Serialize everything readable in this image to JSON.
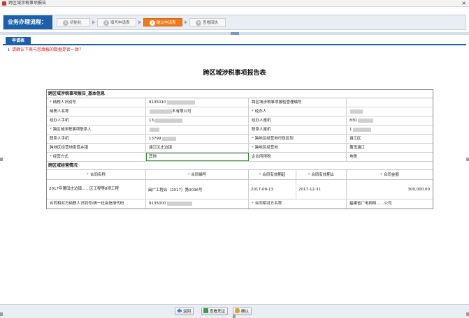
{
  "window": {
    "title": "跨区域涉税事项报告"
  },
  "flow": {
    "title": "业务办理流程：",
    "steps": [
      {
        "num": "1",
        "label": "初始化"
      },
      {
        "num": "2",
        "label": "填写申请表"
      },
      {
        "num": "3",
        "label": "确认申请表"
      },
      {
        "num": "4",
        "label": "查看回执"
      }
    ],
    "active_index": 2
  },
  "tab": {
    "label": "申请表"
  },
  "notice": "请确认下表与您填报的数据是否一致？",
  "report": {
    "title": "跨区域涉税事项报告表",
    "basic_section": "跨区域涉税事项报告_基本信息",
    "rows": [
      {
        "l1": "纳税人识别号",
        "s1": true,
        "v1": "9135010",
        "l2": "跨区域涉税事项报验管理编号",
        "s2": false,
        "v2": ""
      },
      {
        "l1": "纳税人名称",
        "s1": false,
        "v1": "木有限公司",
        "l2": "经办人",
        "s2": true,
        "v2": ""
      },
      {
        "l1": "经办人手机",
        "s1": false,
        "v1": "13",
        "l2": "经办人座机",
        "s2": false,
        "v2": "830"
      },
      {
        "l1": "跨区域涉税事项联系人",
        "s1": true,
        "v1": "",
        "l2": "联系人座机",
        "s2": false,
        "v2": "1"
      },
      {
        "l1": "联系人手机",
        "s1": false,
        "v1": "13799",
        "l2": "跨地区经营地行政区划",
        "s2": true,
        "v2": "涵江区"
      },
      {
        "l1": "跨地区经营地街道乡镇",
        "s1": false,
        "v1": "涵江区庄边镇",
        "l2": "跨地区经营地",
        "s2": true,
        "v2": "莆田涵江"
      },
      {
        "l1": "经营方式",
        "s1": true,
        "v1": "其他",
        "l2": "企业所得税",
        "s2": false,
        "v2": "地税"
      }
    ],
    "ops_section": "跨区域经营情况",
    "contract_headers": [
      "合同名称",
      "合同编号",
      "合同有效期起",
      "合同有效期止",
      "合同金额"
    ],
    "contract": {
      "name": "2017年莆田庄边镇……区工程等8项工程",
      "number": "闽广工程合（2017）第0036号",
      "start": "2017-09-13",
      "end": "2017-12-31",
      "amount": "300,000.00"
    },
    "counterparty": {
      "id_label": "合同相对方纳税人识别号/统一社会信用代码",
      "id_value": "9135000",
      "name_label": "合同相对方名称",
      "name_value": "福建省广电网络……公司"
    }
  },
  "buttons": {
    "back": "返回",
    "view_voucher": "查看凭证",
    "confirm": "确认"
  }
}
